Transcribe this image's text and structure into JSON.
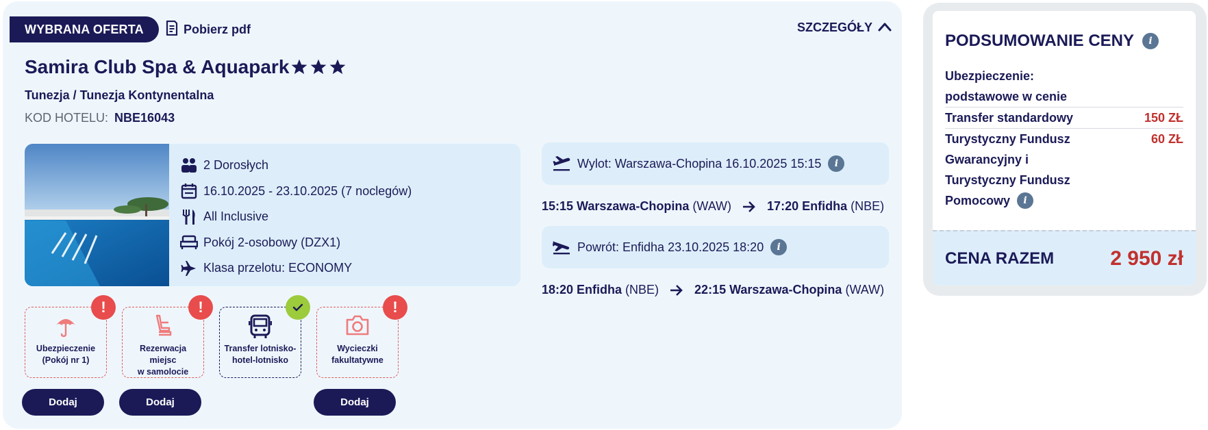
{
  "offer": {
    "badge": "WYBRANA OFERTA",
    "pdf_label": "Pobierz pdf",
    "details_label": "SZCZEGÓŁY",
    "hotel_name": "Samira Club Spa & Aquapark",
    "stars": 3,
    "region": "Tunezja / Tunezja Kontynentalna",
    "code_label": "KOD HOTELU:",
    "code_value": "NBE16043"
  },
  "info": {
    "travelers": "2 Dorosłych",
    "dates": "16.10.2025 - 23.10.2025 (7 noclegów)",
    "board": "All Inclusive",
    "room": "Pokój 2-osobowy (DZX1)",
    "flight_class": "Klasa przelotu: ECONOMY"
  },
  "extras": [
    {
      "line1": "Ubezpieczenie",
      "line2": "(Pokój nr 1)",
      "status": "warning",
      "icon": "umbrella-icon",
      "button": "Dodaj"
    },
    {
      "line1": "Rezerwacja miejsc",
      "line2": "w samolocie",
      "status": "warning",
      "icon": "seat-icon",
      "button": "Dodaj"
    },
    {
      "line1": "Transfer lotnisko-",
      "line2": "hotel-lotnisko",
      "status": "ok",
      "icon": "bus-icon",
      "button": ""
    },
    {
      "line1": "Wycieczki",
      "line2": "fakultatywne",
      "status": "warning",
      "icon": "camera-icon",
      "button": "Dodaj"
    }
  ],
  "flights": {
    "outbound": {
      "label": "Wylot: Warszawa-Chopina 16.10.2025 15:15",
      "dep": "15:15 Warszawa-Chopina",
      "dep_code": "(WAW)",
      "arr": "17:20 Enfidha",
      "arr_code": "(NBE)"
    },
    "inbound": {
      "label": "Powrót: Enfidha 23.10.2025 18:20",
      "dep": "18:20 Enfidha",
      "dep_code": "(NBE)",
      "arr": "22:15 Warszawa-Chopina",
      "arr_code": "(WAW)"
    }
  },
  "summary": {
    "title": "PODSUMOWANIE CENY",
    "insurance_label": "Ubezpieczenie:",
    "insurance_value": "podstawowe w cenie",
    "transfer_label": "Transfer standardowy",
    "transfer_price": "150 ZŁ",
    "fund_l1": "Turystyczny Fundusz",
    "fund_l2": "Gwarancyjny i",
    "fund_l3": "Turystyczny Fundusz",
    "fund_l4": "Pomocowy",
    "fund_price": "60 ZŁ",
    "total_label": "CENA RAZEM",
    "total_value": "2 950 zł"
  },
  "colors": {
    "navy": "#1b1a57",
    "panel": "#eef6fc",
    "panel_inner": "#ddeefa",
    "price_red": "#c0312e",
    "warning_red": "#e84c4c",
    "ok_green": "#9ccb3b"
  }
}
